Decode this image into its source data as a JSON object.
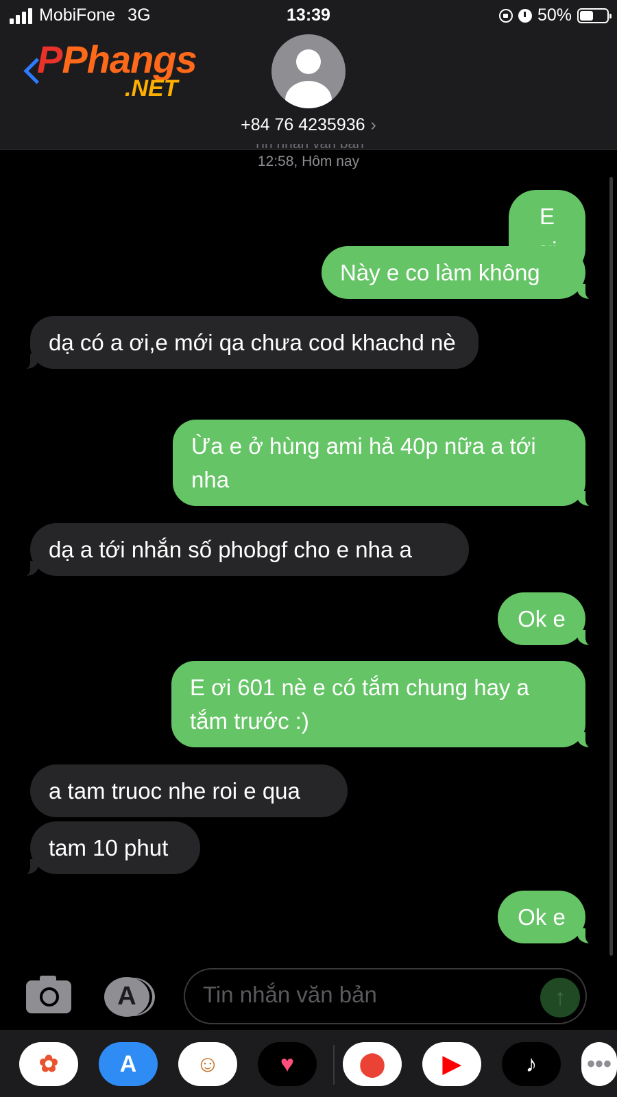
{
  "status_bar": {
    "carrier": "MobiFone",
    "network": "3G",
    "time": "13:39",
    "battery": "50%",
    "battery_level": 0.5
  },
  "header": {
    "logo_text_main": "Phangs",
    "logo_text_sub": ".NET",
    "contact": "+84 76 4235936",
    "contact_arrow": "›"
  },
  "thread": {
    "service_label": "Tin nhắn văn bản",
    "timestamp": "12:58, Hôm nay",
    "messages": [
      {
        "dir": "out",
        "text": "E ơi"
      },
      {
        "dir": "out",
        "text": "Này e co làm không"
      },
      {
        "dir": "in",
        "text": "dạ có a ơi,e mới qa chưa cod khachd nè"
      },
      {
        "dir": "out",
        "text": "Ừa e ở hùng ami hả 40p nữa a tới nha"
      },
      {
        "dir": "in",
        "text": "dạ a tới nhắn số phobgf cho e nha a"
      },
      {
        "dir": "out",
        "text": "Ok e"
      },
      {
        "dir": "out",
        "text": "E ơi 601 nè e có tắm chung hay a tắm trước :)"
      },
      {
        "dir": "in",
        "text": "a tam truoc nhe roi e qua"
      },
      {
        "dir": "in",
        "text": "tam 10 phut"
      },
      {
        "dir": "out",
        "text": "Ok e"
      }
    ]
  },
  "composer": {
    "placeholder": "Tin nhắn văn bản",
    "send_glyph": "↑",
    "appstore_glyph": "A"
  },
  "dock": {
    "apps": [
      {
        "name": "photos-app-icon",
        "glyph": "✿",
        "bg": "#ffffff",
        "fg": "#e8542f"
      },
      {
        "name": "appstore-app-icon",
        "glyph": "A",
        "bg": "#2f8cf4",
        "fg": "#ffffff"
      },
      {
        "name": "memoji-app-icon",
        "glyph": "☺",
        "bg": "#ffffff",
        "fg": "#c8732a"
      },
      {
        "name": "fitness-heart-app-icon",
        "glyph": "♥",
        "bg": "#000000",
        "fg": "#ff4f7a"
      },
      {
        "name": "maps-app-icon",
        "glyph": "⬤",
        "bg": "#ffffff",
        "fg": "#ea4335"
      },
      {
        "name": "youtube-app-icon",
        "glyph": "▶",
        "bg": "#ffffff",
        "fg": "#ff0000"
      },
      {
        "name": "tiktok-app-icon",
        "glyph": "♪",
        "bg": "#000000",
        "fg": "#ffffff"
      },
      {
        "name": "more-app-icon",
        "glyph": "•••",
        "bg": "#ffffff",
        "fg": "#8e8e93"
      }
    ]
  },
  "colors": {
    "outgoing_bubble": "#65c466",
    "incoming_bubble": "#262628",
    "background": "#000000"
  }
}
